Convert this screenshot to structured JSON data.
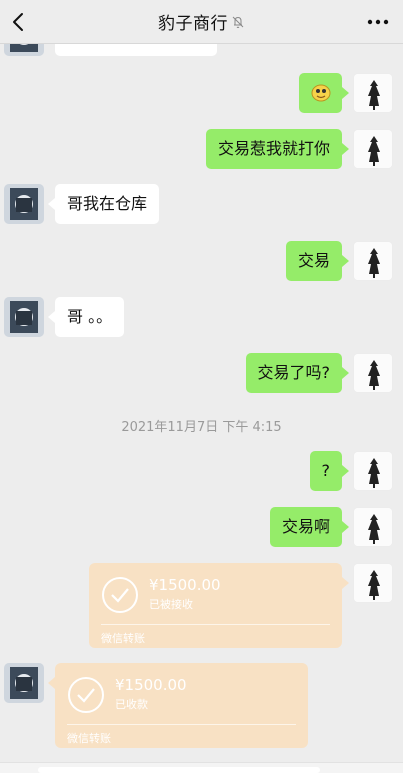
{
  "header": {
    "title": "豹子商行",
    "back_icon": "chevron-left-icon",
    "mute_icon": "bell-off-icon",
    "more_icon": "ellipsis-icon"
  },
  "messages": [
    {
      "side": "self",
      "text": "交易惹我就打你"
    },
    {
      "side": "other",
      "text": "哥我在仓库"
    },
    {
      "side": "self",
      "text": "交易"
    },
    {
      "side": "other",
      "text": "哥 。。"
    },
    {
      "side": "self",
      "text": "交易了吗?"
    },
    {
      "side": "self",
      "text": "?"
    },
    {
      "side": "self",
      "text": "交易啊"
    }
  ],
  "timestamp": "2021年11月7日 下午 4:15",
  "transfers": [
    {
      "side": "self",
      "amount": "¥1500.00",
      "status": "已被接收",
      "service": "微信转账"
    },
    {
      "side": "other",
      "amount": "¥1500.00",
      "status": "已收款",
      "service": "微信转账"
    }
  ],
  "colors": {
    "self_bubble": "#95ec69",
    "other_bubble": "#ffffff",
    "transfer_card": "#f8e1c4",
    "background": "#ededed"
  }
}
